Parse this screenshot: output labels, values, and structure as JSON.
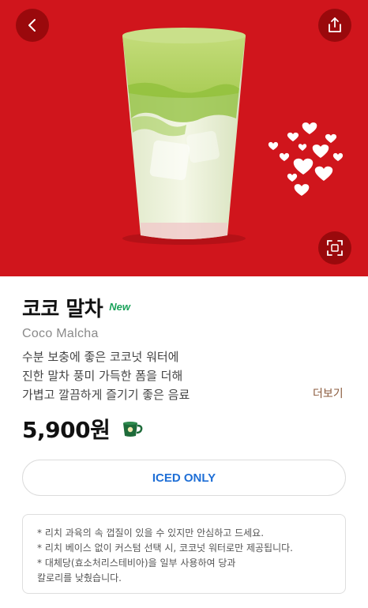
{
  "hero": {
    "background_color": "#d0151c",
    "back_icon": "chevron-left-icon",
    "share_icon": "share-icon",
    "zoom_icon": "fullscreen-icon"
  },
  "product": {
    "name_ko": "코코 말차",
    "badge": "New",
    "name_en": "Coco Malcha",
    "description_lines": [
      "수분 보충에 좋은 코코넛 워터에",
      "진한 말차 풍미 가득한 폼을 더해",
      "가볍고 깔끔하게 즐기기 좋은 음료"
    ],
    "more_label": "더보기",
    "price": "5,900원",
    "cup_icon": "mug-icon"
  },
  "option": {
    "label": "ICED ONLY"
  },
  "notice": {
    "lines": [
      "* 리치 과육의 속 껍질이 있을 수 있지만 안심하고 드세요.",
      "* 리치 베이스 없이 커스텀 선택 시, 코코넛 워터로만 제공됩니다.",
      "* 대체당(효소처리스테비아)을 일부 사용하여 당과",
      "칼로리를 낮췄습니다."
    ]
  },
  "colors": {
    "accent_blue": "#1f6fd6",
    "new_green": "#1aa25a",
    "more_brown": "#8a5a3c"
  }
}
